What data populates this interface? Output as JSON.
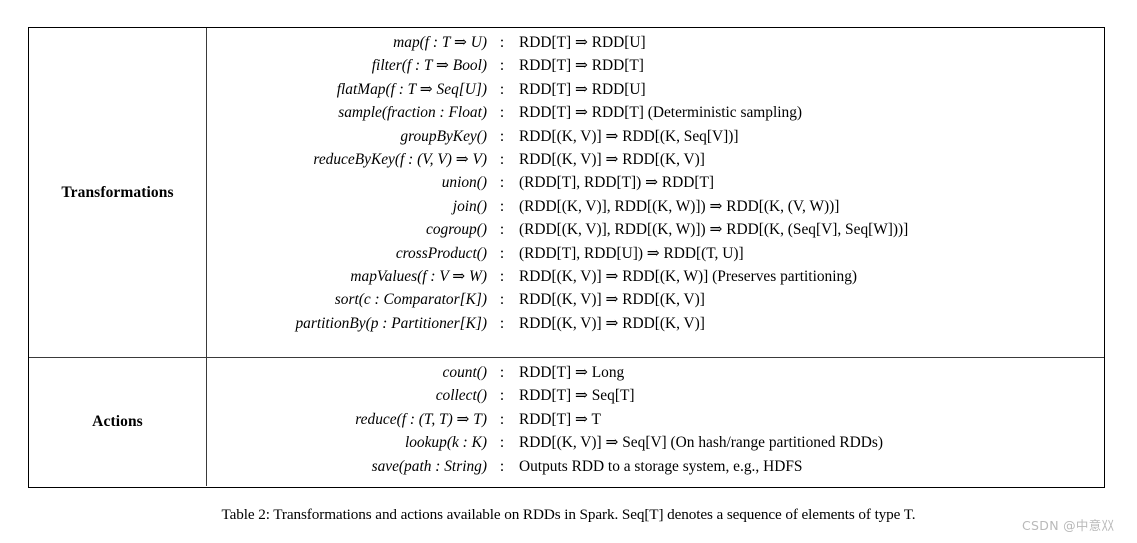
{
  "table": {
    "sections": [
      {
        "label": "Transformations",
        "rows": [
          {
            "signature": "map(f : T ⇒ U)",
            "colon": ":",
            "type": "RDD[T] ⇒ RDD[U]"
          },
          {
            "signature": "filter(f : T ⇒ Bool)",
            "colon": ":",
            "type": "RDD[T] ⇒ RDD[T]"
          },
          {
            "signature": "flatMap(f : T ⇒ Seq[U])",
            "colon": ":",
            "type": "RDD[T] ⇒ RDD[U]"
          },
          {
            "signature": "sample(fraction : Float)",
            "colon": ":",
            "type": "RDD[T] ⇒ RDD[T]  (Deterministic sampling)"
          },
          {
            "signature": "groupByKey()",
            "colon": ":",
            "type": "RDD[(K, V)] ⇒ RDD[(K, Seq[V])]"
          },
          {
            "signature": "reduceByKey(f : (V, V) ⇒ V)",
            "colon": ":",
            "type": "RDD[(K, V)] ⇒ RDD[(K, V)]"
          },
          {
            "signature": "union()",
            "colon": ":",
            "type": "(RDD[T], RDD[T]) ⇒ RDD[T]"
          },
          {
            "signature": "join()",
            "colon": ":",
            "type": "(RDD[(K, V)], RDD[(K, W)]) ⇒ RDD[(K, (V, W))]"
          },
          {
            "signature": "cogroup()",
            "colon": ":",
            "type": "(RDD[(K, V)], RDD[(K, W)]) ⇒ RDD[(K, (Seq[V], Seq[W]))]"
          },
          {
            "signature": "crossProduct()",
            "colon": ":",
            "type": "(RDD[T], RDD[U]) ⇒ RDD[(T, U)]"
          },
          {
            "signature": "mapValues(f : V ⇒ W)",
            "colon": ":",
            "type": "RDD[(K, V)] ⇒ RDD[(K, W)]  (Preserves partitioning)"
          },
          {
            "signature": "sort(c : Comparator[K])",
            "colon": ":",
            "type": "RDD[(K, V)] ⇒ RDD[(K, V)]"
          },
          {
            "signature": "partitionBy(p : Partitioner[K])",
            "colon": ":",
            "type": "RDD[(K, V)] ⇒ RDD[(K, V)]"
          }
        ]
      },
      {
        "label": "Actions",
        "rows": [
          {
            "signature": "count()",
            "colon": ":",
            "type": "RDD[T] ⇒ Long"
          },
          {
            "signature": "collect()",
            "colon": ":",
            "type": "RDD[T] ⇒ Seq[T]"
          },
          {
            "signature": "reduce(f : (T, T) ⇒ T)",
            "colon": ":",
            "type": "RDD[T] ⇒ T"
          },
          {
            "signature": "lookup(k : K)",
            "colon": ":",
            "type": "RDD[(K, V)] ⇒ Seq[V]  (On hash/range partitioned RDDs)"
          },
          {
            "signature": "save(path : String)",
            "colon": ":",
            "type": "Outputs RDD to a storage system, e.g., HDFS"
          }
        ]
      }
    ]
  },
  "caption": "Table 2: Transformations and actions available on RDDs in Spark. Seq[T] denotes a sequence of elements of type T.",
  "watermark": "CSDN @中意〷",
  "colors": {
    "background": "#ffffff",
    "text": "#000000",
    "border": "#000000",
    "inner_rule": "#3a3a3a",
    "watermark": "#b9b9b9"
  }
}
